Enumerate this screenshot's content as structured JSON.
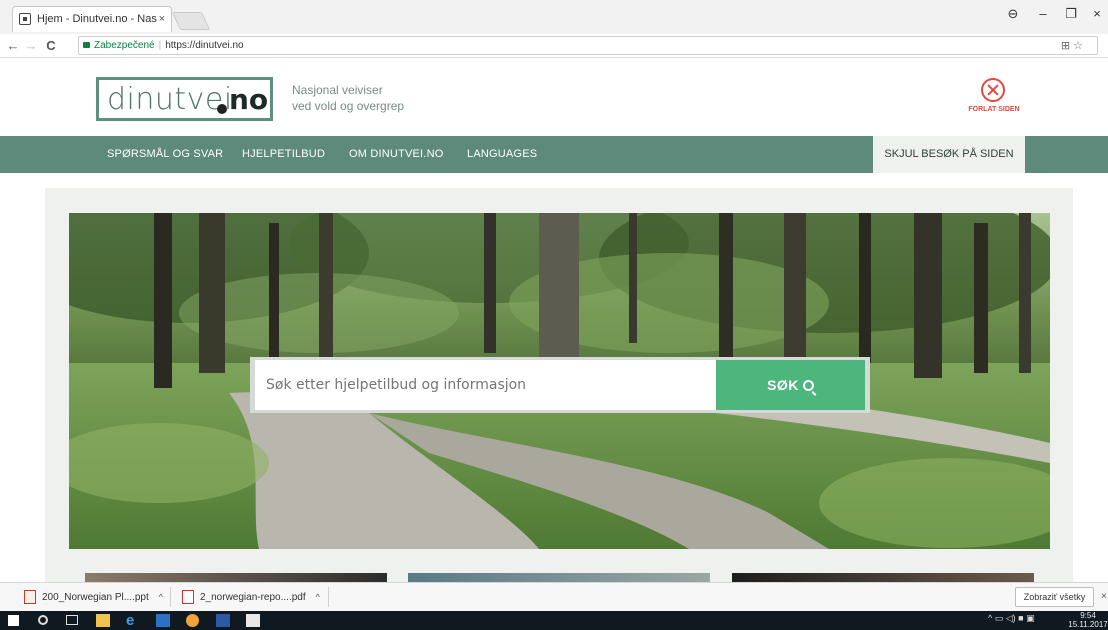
{
  "browser": {
    "tab_title": "Hjem - Dinutvei.no - Nas",
    "tab_close": "×",
    "secure_label": "Zabezpečené",
    "url": "https://dinutvei.no",
    "window_controls": {
      "profile": "⊖",
      "minimize": "–",
      "maximize": "❐",
      "close": "×"
    }
  },
  "header": {
    "logo_main": "dinutvei",
    "logo_tld": "no",
    "tagline_line1": "Nasjonal veiviser",
    "tagline_line2": "ved vold og overgrep",
    "exit_label": "FORLAT SIDEN"
  },
  "nav": {
    "items": [
      {
        "label": "SPØRSMÅL OG SVAR"
      },
      {
        "label": "HJELPETILBUD"
      },
      {
        "label": "OM DINUTVEI.NO"
      },
      {
        "label": "LANGUAGES"
      }
    ],
    "hide_visit": "SKJUL BESØK PÅ SIDEN"
  },
  "search": {
    "placeholder": "Søk etter hjelpetilbud og informasjon",
    "button_label": "SØK"
  },
  "downloads": {
    "items": [
      {
        "label": "200_Norwegian Pl....ppt"
      },
      {
        "label": "2_norwegian-repo....pdf"
      }
    ],
    "caret": "^",
    "show_all": "Zobraziť všetky",
    "close": "×"
  },
  "taskbar": {
    "time": "9:54",
    "date": "15.11.2017"
  },
  "colors": {
    "brand_green": "#5e8a7b",
    "search_button": "#4db67c",
    "exit_red": "#e8453c"
  }
}
